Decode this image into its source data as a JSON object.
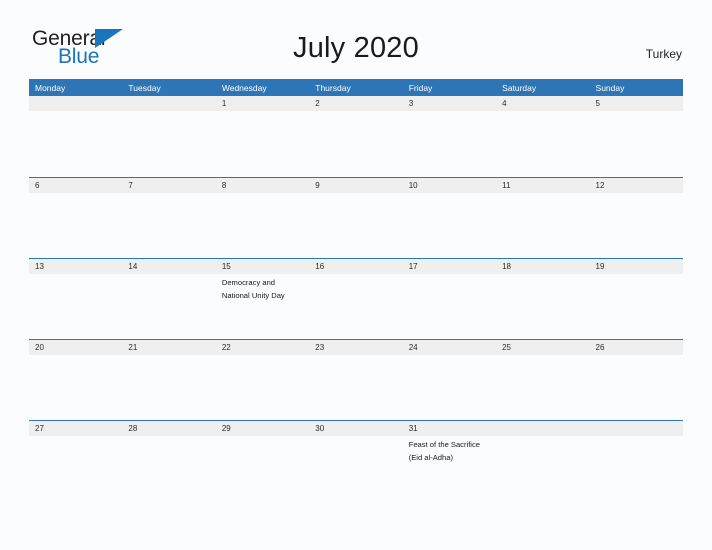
{
  "brand": {
    "name_top": "General",
    "name_bottom": "Blue",
    "top_color": "#231f20",
    "bottom_color": "#1b75bb",
    "triangle_color": "#1b75bb"
  },
  "header": {
    "title": "July 2020",
    "country": "Turkey"
  },
  "colors": {
    "header_blue": "#2e75b6",
    "row_divider_blue": "#2e75b6",
    "day_band_gray": "#efefef",
    "page_background": "#fbfcfd",
    "text_dark": "#1a1a1a"
  },
  "calendar": {
    "weekdays": [
      "Monday",
      "Tuesday",
      "Wednesday",
      "Thursday",
      "Friday",
      "Saturday",
      "Sunday"
    ],
    "weeks": [
      [
        {
          "date": "",
          "events": []
        },
        {
          "date": "",
          "events": []
        },
        {
          "date": "1",
          "events": []
        },
        {
          "date": "2",
          "events": []
        },
        {
          "date": "3",
          "events": []
        },
        {
          "date": "4",
          "events": []
        },
        {
          "date": "5",
          "events": []
        }
      ],
      [
        {
          "date": "6",
          "events": []
        },
        {
          "date": "7",
          "events": []
        },
        {
          "date": "8",
          "events": []
        },
        {
          "date": "9",
          "events": []
        },
        {
          "date": "10",
          "events": []
        },
        {
          "date": "11",
          "events": []
        },
        {
          "date": "12",
          "events": []
        }
      ],
      [
        {
          "date": "13",
          "events": []
        },
        {
          "date": "14",
          "events": []
        },
        {
          "date": "15",
          "events": [
            "Democracy and National Unity Day"
          ]
        },
        {
          "date": "16",
          "events": []
        },
        {
          "date": "17",
          "events": []
        },
        {
          "date": "18",
          "events": []
        },
        {
          "date": "19",
          "events": []
        }
      ],
      [
        {
          "date": "20",
          "events": []
        },
        {
          "date": "21",
          "events": []
        },
        {
          "date": "22",
          "events": []
        },
        {
          "date": "23",
          "events": []
        },
        {
          "date": "24",
          "events": []
        },
        {
          "date": "25",
          "events": []
        },
        {
          "date": "26",
          "events": []
        }
      ],
      [
        {
          "date": "27",
          "events": []
        },
        {
          "date": "28",
          "events": []
        },
        {
          "date": "29",
          "events": []
        },
        {
          "date": "30",
          "events": []
        },
        {
          "date": "31",
          "events": [
            "Feast of the Sacrifice (Eid al-Adha)"
          ]
        },
        {
          "date": "",
          "events": []
        },
        {
          "date": "",
          "events": []
        }
      ]
    ]
  }
}
